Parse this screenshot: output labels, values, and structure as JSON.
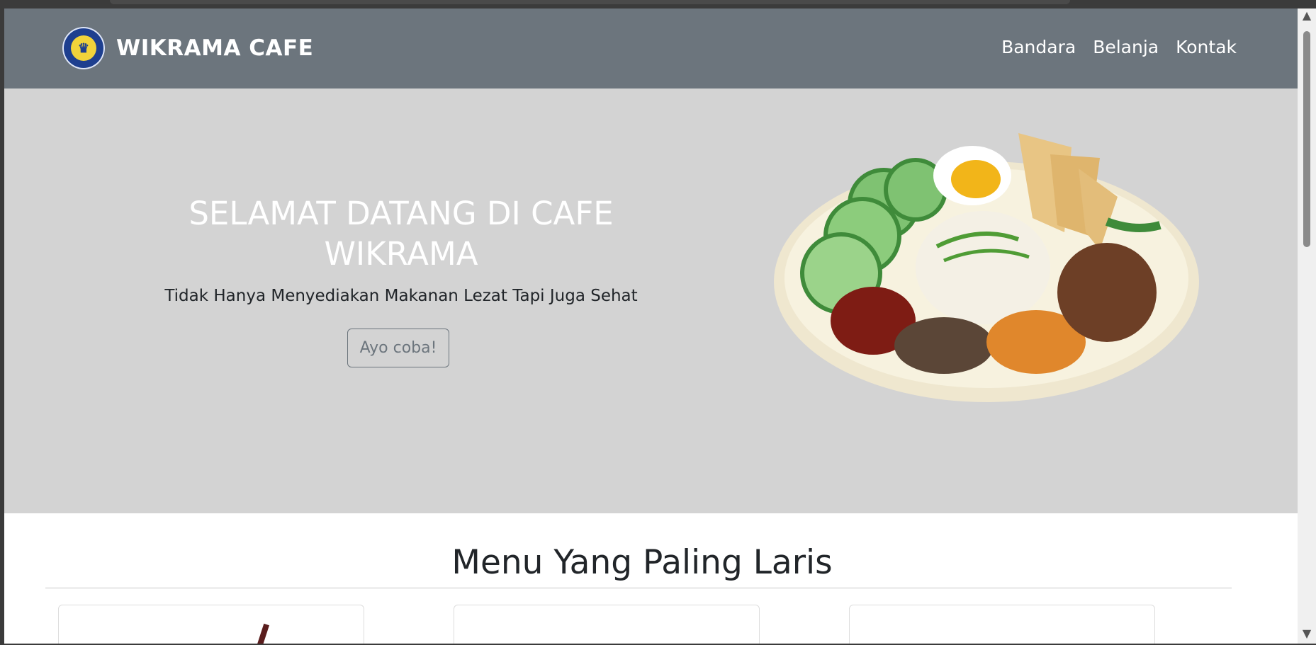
{
  "navbar": {
    "brand_text": "WIKRAMA CAFE",
    "logo_icon": "school-logo-icon",
    "links": [
      "Bandara",
      "Belanja",
      "Kontak"
    ]
  },
  "hero": {
    "title": "SELAMAT DATANG DI CAFE WIKRAMA",
    "subtitle": "Tidak Hanya Menyediakan Makanan Lezat Tapi Juga Sehat",
    "button_label": "Ayo coba!",
    "image_icon": "nasi-lemak-plate-illustration"
  },
  "section": {
    "title": "Menu Yang Paling Laris"
  },
  "colors": {
    "navbar_bg": "#6c757d",
    "hero_bg": "#d3d3d3",
    "button_outline": "#6c757d"
  }
}
